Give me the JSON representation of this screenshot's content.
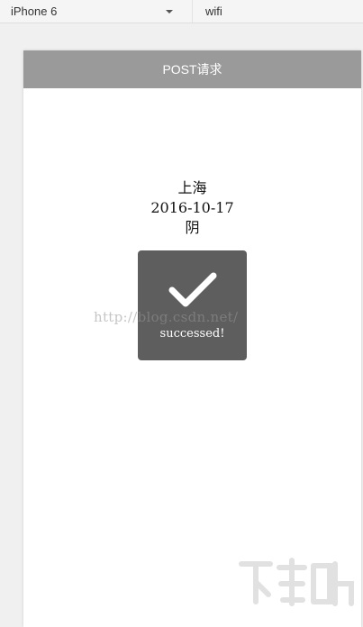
{
  "toolbar": {
    "device": "iPhone 6",
    "network": "wifi"
  },
  "app": {
    "title": "POST请求",
    "city": "上海",
    "date": "2016-10-17",
    "weather": "阴"
  },
  "toast": {
    "icon": "checkmark-icon",
    "message": "successed!"
  },
  "watermark": "http://blog.csdn.net/",
  "colors": {
    "navbar": "#9a9a9a",
    "toast": "#5e5e5e"
  }
}
